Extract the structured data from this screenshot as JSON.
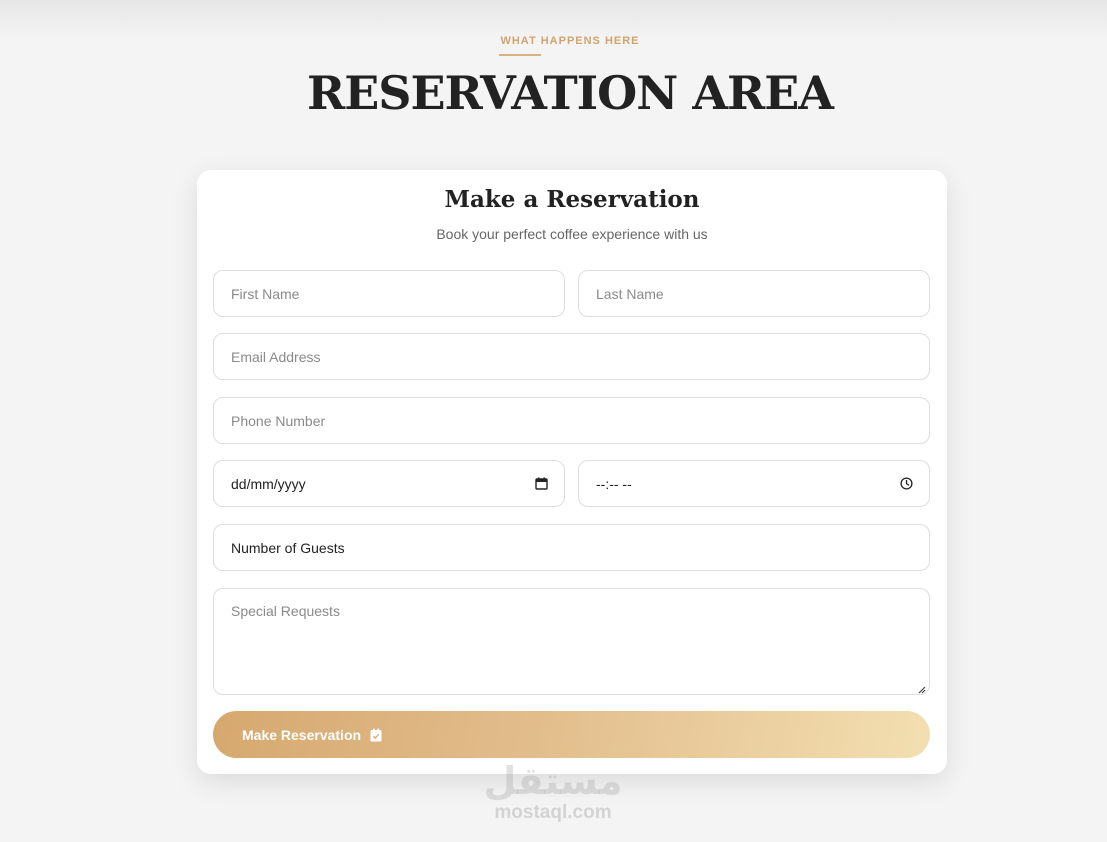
{
  "section": {
    "eyebrow": "WHAT HAPPENS HERE",
    "title": "RESERVATION AREA"
  },
  "form": {
    "title": "Make a Reservation",
    "subtitle": "Book your perfect coffee experience with us",
    "first_name": {
      "placeholder": "First Name"
    },
    "last_name": {
      "placeholder": "Last Name"
    },
    "email": {
      "placeholder": "Email Address"
    },
    "phone": {
      "placeholder": "Phone Number"
    },
    "date": {
      "value": "dd/mm/yyyy",
      "icon": "calendar-icon"
    },
    "time": {
      "value": "--:-- --",
      "icon": "clock-icon"
    },
    "guests": {
      "value": "Number of Guests"
    },
    "requests": {
      "placeholder": "Special Requests"
    },
    "submit": {
      "label": "Make Reservation",
      "icon": "calendar-check-icon"
    }
  },
  "colors": {
    "accent": "#d1a46c",
    "button_start": "#d6a86f",
    "button_end": "#f3dfb1",
    "background": "#f4f4f4"
  },
  "watermark": {
    "arabic": "مستقل",
    "latin": "mostaql.com"
  }
}
